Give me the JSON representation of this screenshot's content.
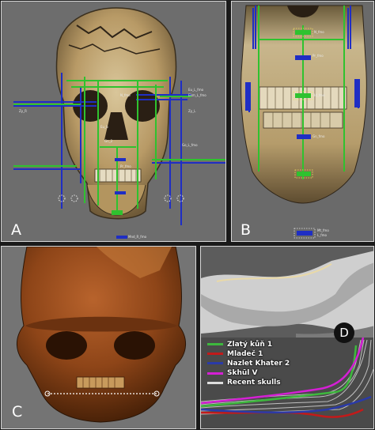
{
  "panels": {
    "a": {
      "letter": "A"
    },
    "b": {
      "letter": "B"
    },
    "c": {
      "letter": "C"
    },
    "d": {
      "letter": "D"
    }
  },
  "landmark_labels": {
    "a_right": [
      "Eu_L_fmo",
      "Ekm_L_fmo",
      "Zy_L",
      "Go_L_fmo"
    ],
    "a_left": [
      "Zy_R"
    ],
    "a_center": [
      "Eu_b",
      "N_fmo",
      "Pr_fmo",
      "Gn_2"
    ],
    "a_bottom": [
      "Mnd_R_fmo"
    ],
    "b_labels": [
      "N_fmo",
      "Pr_fmo",
      "Id_fmo",
      "Gn_fmo"
    ],
    "b_bottom": [
      "Mt_fmo",
      "L_fmo"
    ]
  },
  "legend": [
    {
      "name": "Zlatý kůň 1",
      "color": "#3db83d"
    },
    {
      "name": "Mladeč 1",
      "color": "#c21a1a"
    },
    {
      "name": "Nazlet Khater 2",
      "color": "#2a3aa8"
    },
    {
      "name": "Skhūl V",
      "color": "#d51fd5"
    },
    {
      "name": "Recent skulls",
      "color": "#dddddd"
    }
  ],
  "colors": {
    "green_line": "#2fc22f",
    "blue_line": "#1f2ec4",
    "bone": "#c9b38a",
    "mesh": "#d8d8d8"
  }
}
